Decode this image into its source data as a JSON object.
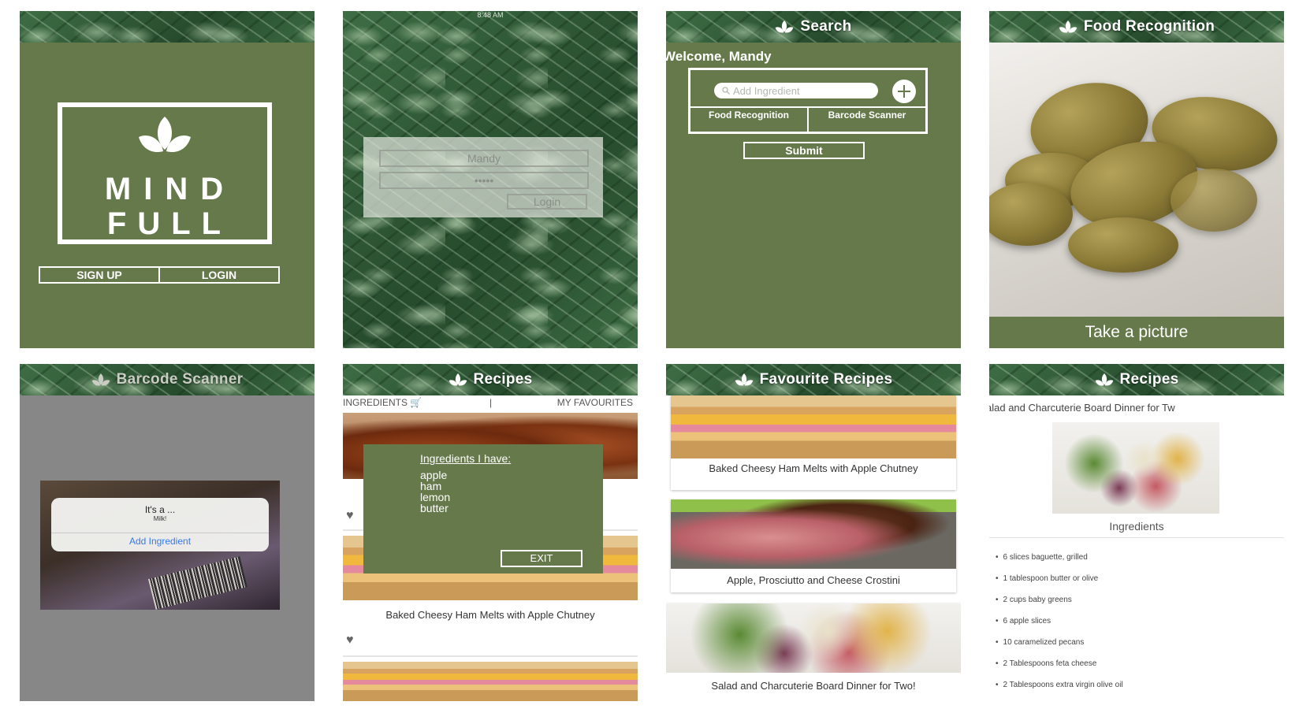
{
  "colors": {
    "brand_green": "#66794a",
    "alert_blue": "#3478f6"
  },
  "screen_launch": {
    "logo_line1": "MIND",
    "logo_line2": "FULL",
    "signup_label": "SIGN UP",
    "login_label": "LOGIN"
  },
  "screen_login": {
    "status_time": "8:48 AM",
    "username_value": "Mandy",
    "password_value": "•••••",
    "login_button": "Login"
  },
  "screen_search": {
    "title": "Search",
    "welcome": "Welcome, Mandy",
    "search_placeholder": "Add Ingredient",
    "food_recognition": "Food Recognition",
    "barcode_scanner": "Barcode Scanner",
    "submit": "Submit"
  },
  "screen_food_recognition": {
    "title": "Food Recognition",
    "take_picture": "Take a picture"
  },
  "screen_barcode": {
    "title": "Barcode Scanner",
    "alert_title": "It's a ...",
    "alert_message": "Milk!",
    "alert_action": "Add Ingredient"
  },
  "screen_recipes": {
    "title": "Recipes",
    "tab_ingredients": "INGREDIENTS",
    "tab_favourites": "MY FAVOURITES",
    "separator": "|",
    "overlay_title": "Ingredients I have:",
    "overlay_items": [
      "apple",
      "ham",
      "lemon",
      "butter"
    ],
    "exit": "EXIT",
    "recipe_caption": "Baked Cheesy Ham Melts with Apple Chutney"
  },
  "screen_favourites": {
    "title": "Favourite Recipes",
    "cards": [
      {
        "caption": "Baked Cheesy Ham Melts with Apple Chutney"
      },
      {
        "caption": "Apple, Prosciutto and Cheese Crostini"
      },
      {
        "caption": "Salad and Charcuterie Board Dinner for Two!"
      }
    ]
  },
  "screen_recipe_detail": {
    "title": "Recipes",
    "recipe_title": "alad and Charcuterie Board Dinner for Tw",
    "ingredients_heading": "Ingredients",
    "ingredients": [
      "6 slices baguette, grilled",
      "1 tablespoon butter or olive",
      "2 cups baby greens",
      "6 apple slices",
      "10 caramelized pecans",
      "2 Tablespoons feta cheese",
      "2 Tablespoons extra virgin olive oil"
    ]
  }
}
